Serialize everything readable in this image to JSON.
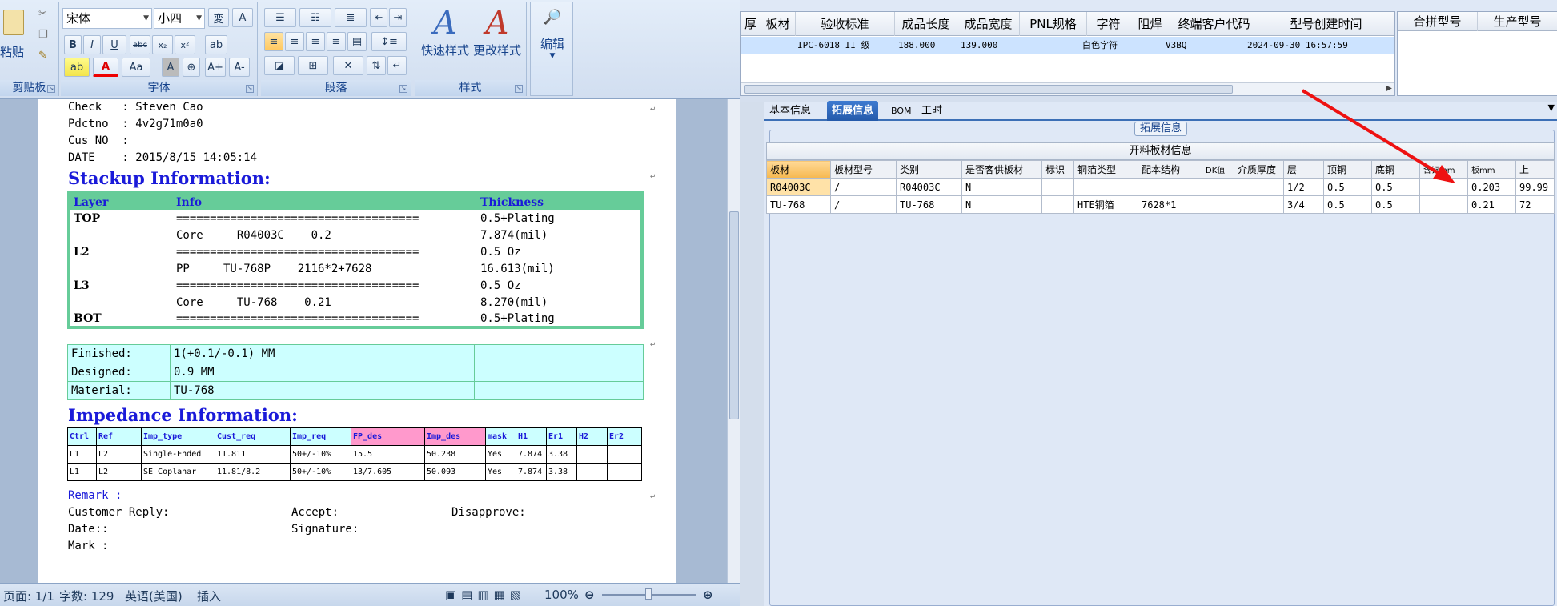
{
  "word": {
    "ribbon": {
      "clipboard": {
        "label": "剪贴板",
        "paste": "粘贴"
      },
      "font": {
        "label": "字体",
        "font_name": "宋体",
        "font_size": "小四"
      },
      "paragraph": {
        "label": "段落"
      },
      "styles": {
        "label": "样式",
        "quick": "快速样式",
        "change": "更改样式"
      },
      "edit": {
        "label": "编辑"
      }
    },
    "document": {
      "check": "Check   : Steven Cao",
      "pdctno": "Pdctno  : 4v2g71m0a0",
      "cusno": "Cus NO  :",
      "date": "DATE    : 2015/8/15 14:05:14",
      "stackup_title": "Stackup Information:",
      "stackup_headers": [
        "Layer",
        "Info",
        "Thickness"
      ],
      "stackup_rows": [
        [
          "TOP",
          "====================================",
          "0.5+Plating"
        ],
        [
          "",
          "Core     R04003C    0.2",
          "7.874(mil)"
        ],
        [
          "L2",
          "====================================",
          "0.5 Oz"
        ],
        [
          "",
          "PP     TU-768P    2116*2+7628",
          "16.613(mil)"
        ],
        [
          "L3",
          "====================================",
          "0.5 Oz"
        ],
        [
          "",
          "Core     TU-768    0.21",
          "8.270(mil)"
        ],
        [
          "BOT",
          "====================================",
          "0.5+Plating"
        ]
      ],
      "finished_rows": [
        [
          "Finished:",
          "1(+0.1/-0.1) MM",
          ""
        ],
        [
          "Designed:",
          "0.9 MM",
          ""
        ],
        [
          "Material:",
          "TU-768",
          ""
        ]
      ],
      "impedance_title": "Impedance Information:",
      "impedance_headers": [
        "Ctrl",
        "Ref",
        "Imp_type",
        "Cust_req",
        "Imp_req",
        "FP_des",
        "Imp_des",
        "mask",
        "H1",
        "Er1",
        "H2",
        "Er2"
      ],
      "impedance_rows": [
        [
          "L1",
          "L2",
          "Single-Ended",
          "11.811",
          "50+/-10%",
          "15.5",
          "50.238",
          "Yes",
          "7.874",
          "3.38",
          "",
          ""
        ],
        [
          "L1",
          "L2",
          "SE Coplanar",
          "11.81/8.2",
          "50+/-10%",
          "13/7.605",
          "50.093",
          "Yes",
          "7.874",
          "3.38",
          "",
          ""
        ]
      ],
      "remark": "Remark :",
      "customer_reply": "Customer Reply:",
      "accept": "Accept:",
      "disapprove": "Disapprove:",
      "date2": "Date::",
      "signature": "Signature:",
      "mark": "Mark :"
    },
    "status": {
      "page": "页面: 1/1",
      "words": "字数: 129",
      "language": "英语(美国)",
      "mode": "插入",
      "zoom": "100%"
    }
  },
  "erp": {
    "top_grid": {
      "headers": [
        "厚",
        "板材",
        "验收标准",
        "成品长度",
        "成品宽度",
        "PNL规格",
        "字符",
        "阻焊",
        "终端客户代码",
        "型号创建时间"
      ],
      "row": [
        "",
        "",
        "IPC-6018 II 级",
        "188.000",
        "139.000",
        "",
        "白色字符",
        "",
        "V3BQ",
        "2024-09-30 16:57:59"
      ]
    },
    "merge_grid": {
      "headers": [
        "合拼型号",
        "生产型号"
      ]
    },
    "tabs": [
      "基本信息",
      "拓展信息",
      "BOM",
      "工时"
    ],
    "active_tab": "拓展信息",
    "fieldset_legend": "拓展信息",
    "material_title": "开料板材信息",
    "material_headers": [
      "板材",
      "板材型号",
      "类别",
      "是否客供板材",
      "标识",
      "铜箔类型",
      "配本结构",
      "DK值",
      "介质厚度",
      "层",
      "顶铜",
      "底铜",
      "含铜mm",
      "板mm",
      "上"
    ],
    "material_rows": [
      [
        "R04003C",
        "/",
        "R04003C",
        "N",
        "",
        "",
        "",
        "",
        "",
        "1/2",
        "0.5",
        "0.5",
        "",
        "0.203",
        "99.99"
      ],
      [
        "TU-768",
        "/",
        "TU-768",
        "N",
        "",
        "HTE铜箔",
        "7628*1",
        "",
        "",
        "3/4",
        "0.5",
        "0.5",
        "",
        "0.21",
        "72"
      ]
    ]
  },
  "colors": {
    "arrow": "#ee1111",
    "tab_active": "#2f66b9",
    "stack_green": "#66cc99",
    "heading_blue": "#1a1ad9"
  }
}
